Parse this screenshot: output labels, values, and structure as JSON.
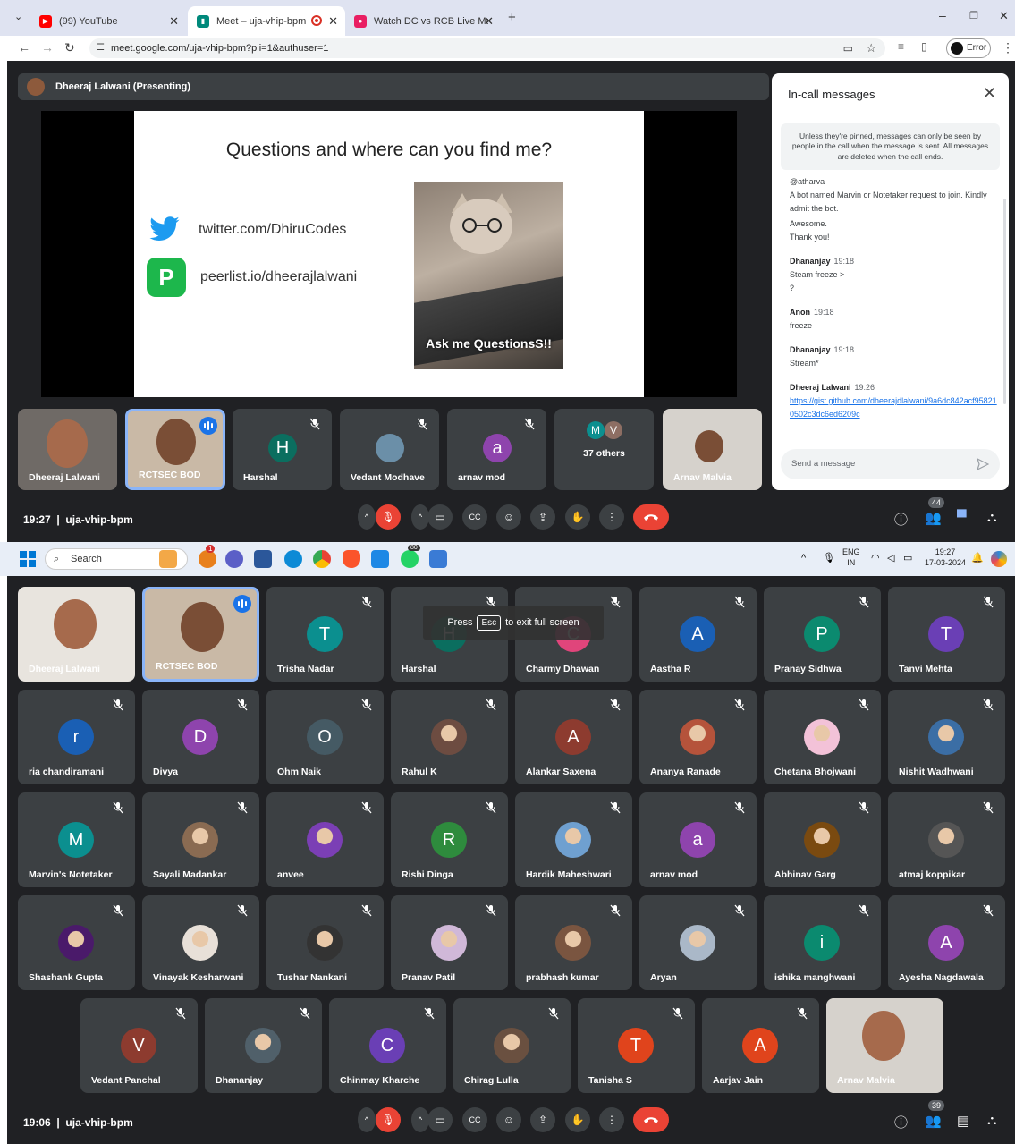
{
  "browser": {
    "tabs": [
      {
        "title": "(99) YouTube",
        "color": "#ff0000"
      },
      {
        "title": "Meet – uja-vhip-bpm",
        "color": "#00897b"
      },
      {
        "title": "Watch DC vs RCB Live Match of",
        "color": "#e91e63"
      }
    ],
    "url": "meet.google.com/uja-vhip-bpm?pli=1&authuser=1",
    "error_label": "Error"
  },
  "top_meet": {
    "presenter": "Dheeraj Lalwani (Presenting)",
    "slide": {
      "title": "Questions and where can you find me?",
      "twitter": "twitter.com/DhiruCodes",
      "peerlist": "peerlist.io/dheerajlalwani",
      "peerlist_logo": "P",
      "caption": "Ask me QuestionsS!!"
    },
    "tiles": [
      {
        "name": "Dheeraj Lalwani"
      },
      {
        "name": "RCTSEC BOD"
      },
      {
        "name": "Harshal",
        "initial": "H",
        "color": "#0b6e5f"
      },
      {
        "name": "Vedant Modhave"
      },
      {
        "name": "arnav mod",
        "initial": "a",
        "color": "#8e44ad"
      },
      {
        "name": "37 others",
        "initials": [
          "M",
          "V"
        ]
      },
      {
        "name": "Arnav Malvia"
      }
    ],
    "time": "19:27",
    "code": "uja-vhip-bpm",
    "people_count": "44"
  },
  "chat": {
    "title": "In-call messages",
    "notice": "Unless they're pinned, messages can only be seen by people in the call when the message is sent. All messages are deleted when the call ends.",
    "early_lines": [
      "@atharva",
      "A bot named Marvin or Notetaker request to join. Kindly admit the bot.",
      "Awesome.",
      "Thank you!"
    ],
    "messages": [
      {
        "sender": "Dhananjay",
        "time": "19:18",
        "lines": [
          "Steam freeze >",
          "?"
        ]
      },
      {
        "sender": "Anon",
        "time": "19:18",
        "lines": [
          "freeze"
        ]
      },
      {
        "sender": "Dhananjay",
        "time": "19:18",
        "lines": [
          "Stream*"
        ]
      },
      {
        "sender": "Dheeraj Lalwani",
        "time": "19:26",
        "link": "https://gist.github.com/dheerajdlalwani/9a6dc842acf958210502c3dc6ed6209c"
      }
    ],
    "placeholder": "Send a message"
  },
  "taskbar": {
    "search": "Search",
    "lang1": "ENG",
    "lang2": "IN",
    "time": "19:27",
    "date": "17-03-2024",
    "whatsapp_badge": "80",
    "notif_badge": "1"
  },
  "bottom_meet": {
    "toast_press": "Press",
    "toast_key": "Esc",
    "toast_rest": "to exit full screen",
    "tiles": [
      {
        "name": "Dheeraj Lalwani",
        "kind": "video"
      },
      {
        "name": "RCTSEC BOD",
        "kind": "video"
      },
      {
        "name": "Trisha Nadar",
        "initial": "T",
        "color": "#0b8f8f"
      },
      {
        "name": "Harshal",
        "initial": "H",
        "color": "#0b6e5f"
      },
      {
        "name": "Charmy Dhawan",
        "initial": "C",
        "color": "#e0457b"
      },
      {
        "name": "Aastha R",
        "initial": "A",
        "color": "#1a5fb4"
      },
      {
        "name": "Pranay Sidhwa",
        "initial": "P",
        "color": "#0b8a6f"
      },
      {
        "name": "Tanvi Mehta",
        "initial": "T",
        "color": "#6a3fb5"
      },
      {
        "name": "ria chandiramani",
        "initial": "r",
        "color": "#1a5fb4"
      },
      {
        "name": "Divya",
        "initial": "D",
        "color": "#8e44ad"
      },
      {
        "name": "Ohm Naik",
        "initial": "O",
        "color": "#455a64"
      },
      {
        "name": "Rahul K",
        "photo": "#6d4c41"
      },
      {
        "name": "Alankar Saxena",
        "initial": "A",
        "color": "#8d3b2f"
      },
      {
        "name": "Ananya Ranade",
        "photo": "#b5533b"
      },
      {
        "name": "Chetana Bhojwani",
        "photo": "#f3c2d8"
      },
      {
        "name": "Nishit Wadhwani",
        "photo": "#3b6ea5"
      },
      {
        "name": "Marvin's Notetaker",
        "initial": "M",
        "color": "#0b8f8f"
      },
      {
        "name": "Sayali Madankar",
        "photo": "#8a6b52"
      },
      {
        "name": "anvee",
        "photo": "#7b3fb5"
      },
      {
        "name": "Rishi Dinga",
        "initial": "R",
        "color": "#2e8b3d"
      },
      {
        "name": "Hardik Maheshwari",
        "photo": "#6fa0d0"
      },
      {
        "name": "arnav mod",
        "initial": "a",
        "color": "#8e44ad"
      },
      {
        "name": "Abhinav Garg",
        "photo": "#7a4a10"
      },
      {
        "name": "atmaj koppikar",
        "photo": "#555"
      },
      {
        "name": "Shashank Gupta",
        "photo": "#4a1a6a"
      },
      {
        "name": "Vinayak Kesharwani",
        "photo": "#e8e0d8"
      },
      {
        "name": "Tushar Nankani",
        "photo": "#333"
      },
      {
        "name": "Pranav Patil",
        "photo": "#d0b8d8"
      },
      {
        "name": "prabhash kumar",
        "photo": "#7a5540"
      },
      {
        "name": "Aryan",
        "photo": "#aab8c8"
      },
      {
        "name": "ishika manghwani",
        "initial": "i",
        "color": "#0b8a6f"
      },
      {
        "name": "Ayesha Nagdawala",
        "initial": "A",
        "color": "#8e44ad"
      },
      {
        "name": "Vedant Panchal",
        "initial": "V",
        "color": "#8d3b2f"
      },
      {
        "name": "Dhananjay",
        "photo": "#50606a"
      },
      {
        "name": "Chinmay Kharche",
        "initial": "C",
        "color": "#6a3fb5"
      },
      {
        "name": "Chirag Lulla",
        "photo": "#6a5040"
      },
      {
        "name": "Tanisha S",
        "initial": "T",
        "color": "#e0441c"
      },
      {
        "name": "Aarjav Jain",
        "initial": "A",
        "color": "#e0441c"
      },
      {
        "name": "Arnav Malvia",
        "kind": "video"
      }
    ],
    "time": "19:06",
    "code": "uja-vhip-bpm",
    "people_count": "39"
  },
  "icons": [
    "chevron-down-icon",
    "youtube-icon",
    "meet-icon",
    "cricket-icon",
    "close-icon",
    "plus-icon",
    "minimize-icon",
    "restore-icon",
    "back-icon",
    "forward-icon",
    "reload-icon",
    "tune-icon",
    "camera-icon",
    "star-icon",
    "playlist-icon",
    "sidepanel-icon",
    "more-icon",
    "mic-off-icon",
    "video-icon",
    "captions-icon",
    "emoji-icon",
    "present-icon",
    "hand-icon",
    "hangup-icon",
    "info-icon",
    "people-icon",
    "chat-icon",
    "activities-icon",
    "send-icon",
    "windows-icon",
    "search-icon",
    "twitter-icon"
  ]
}
